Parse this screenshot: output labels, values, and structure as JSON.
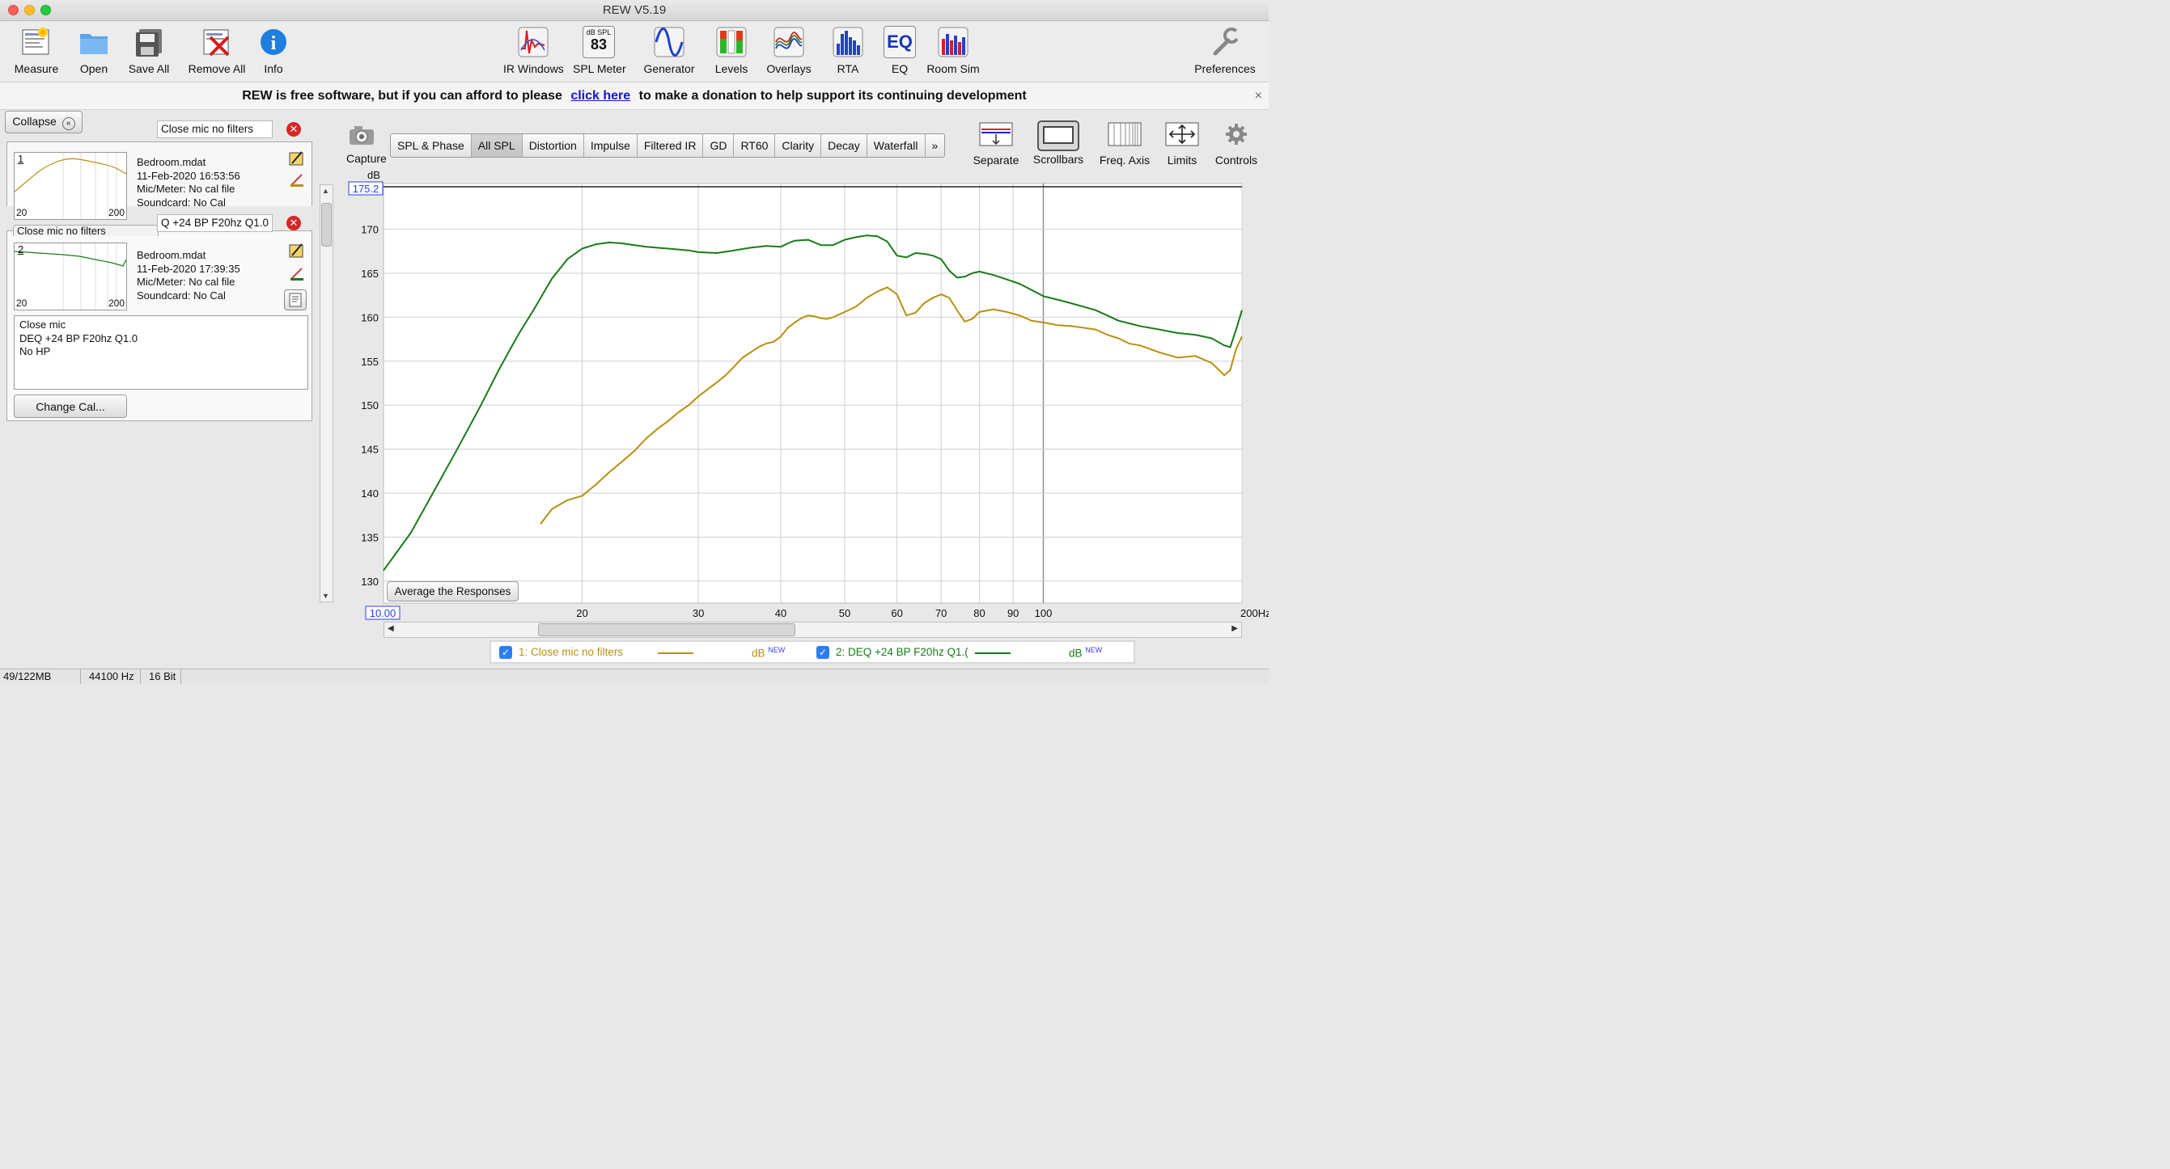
{
  "window": {
    "title": "REW V5.19"
  },
  "toolbar": {
    "measure": "Measure",
    "open": "Open",
    "save_all": "Save All",
    "remove_all": "Remove All",
    "info": "Info",
    "ir_windows": "IR Windows",
    "spl_meter": "SPL Meter",
    "spl_meter_icon_top": "dB SPL",
    "spl_meter_icon_value": "83",
    "generator": "Generator",
    "levels": "Levels",
    "overlays": "Overlays",
    "rta": "RTA",
    "eq": "EQ",
    "eq_icon_text": "EQ",
    "room_sim": "Room Sim",
    "preferences": "Preferences"
  },
  "banner": {
    "text_before": "REW is free software, but if you can afford to please",
    "link": "click here",
    "text_after": "to make a donation to help support its continuing development",
    "close": "×"
  },
  "left_panel": {
    "collapse": "Collapse",
    "measurements": [
      {
        "number": "1",
        "name": "Close mic no filters",
        "file": "Bedroom.mdat",
        "date": "11-Feb-2020 16:53:56",
        "mic": "Mic/Meter: No cal file",
        "soundcard": "Soundcard: No Cal",
        "axis_min": "20",
        "axis_max": "200",
        "color": "#b8900d"
      },
      {
        "number": "2",
        "name": "Q +24 BP F20hz Q1.0",
        "tab_label": "Close mic no filters",
        "file": "Bedroom.mdat",
        "date": "11-Feb-2020 17:39:35",
        "mic": "Mic/Meter: No cal file",
        "soundcard": "Soundcard: No Cal",
        "axis_min": "20",
        "axis_max": "200",
        "color": "#1a7a1a"
      }
    ],
    "notes": [
      "Close mic",
      "DEQ +24 BP F20hz Q1.0",
      "No HP"
    ],
    "change_cal": "Change Cal..."
  },
  "graph_tabs": [
    "SPL & Phase",
    "All SPL",
    "Distortion",
    "Impulse",
    "Filtered IR",
    "GD",
    "RT60",
    "Clarity",
    "Decay",
    "Waterfall",
    "»"
  ],
  "active_tab": "All SPL",
  "capture": "Capture",
  "right_tools": {
    "separate": "Separate",
    "scrollbars": "Scrollbars",
    "freq_axis": "Freq. Axis",
    "limits": "Limits",
    "controls": "Controls"
  },
  "average_button": "Average the Responses",
  "legend": [
    {
      "label": "1: Close mic no filters",
      "unit": "dB",
      "tag": "NEW",
      "color": "#b8900d"
    },
    {
      "label": "2: DEQ +24 BP F20hz Q1.(",
      "unit": "dB",
      "tag": "NEW",
      "color": "#1a7a1a"
    }
  ],
  "status": {
    "memory": "49/122MB",
    "rate": "44100 Hz",
    "bits": "16 Bit"
  },
  "chart_data": {
    "type": "line",
    "xlabel": "",
    "ylabel": "dB",
    "x_scale": "log",
    "xlim": [
      10,
      200
    ],
    "ylim_top_label": "175.2",
    "xlim_left_label": "10.00",
    "ylim": [
      127.5,
      175.2
    ],
    "x_ticks": [
      20,
      30,
      40,
      50,
      60,
      70,
      80,
      90,
      100,
      200
    ],
    "x_tick_labels": [
      "20",
      "30",
      "40",
      "50",
      "60",
      "70",
      "80",
      "90",
      "100",
      "200Hz"
    ],
    "y_ticks": [
      130,
      135,
      140,
      145,
      150,
      155,
      160,
      165,
      170
    ],
    "grid": true,
    "series": [
      {
        "name": "1: Close mic no filters",
        "color": "#b8900d",
        "x": [
          17.3,
          18,
          19,
          20,
          21,
          22,
          23,
          24,
          25,
          26,
          27,
          28,
          29,
          30,
          31,
          32,
          33,
          34,
          35,
          36,
          37,
          38,
          39,
          40,
          41,
          42,
          43,
          44,
          45,
          46,
          47,
          48,
          50,
          52,
          54,
          56,
          58,
          60,
          62,
          64,
          66,
          68,
          70,
          72,
          74,
          76,
          78,
          80,
          84,
          88,
          92,
          96,
          100,
          105,
          110,
          115,
          120,
          125,
          130,
          135,
          140,
          150,
          160,
          170,
          180,
          188,
          192,
          196,
          200
        ],
        "y": [
          136.5,
          138.2,
          139.2,
          139.7,
          141.0,
          142.4,
          143.6,
          144.8,
          146.2,
          147.3,
          148.2,
          149.2,
          150.0,
          151.0,
          151.8,
          152.6,
          153.4,
          154.4,
          155.4,
          156.0,
          156.6,
          157.0,
          157.2,
          157.8,
          158.8,
          159.4,
          159.9,
          160.2,
          160.1,
          159.9,
          159.8,
          160.0,
          160.6,
          161.2,
          162.2,
          162.9,
          163.4,
          162.6,
          160.2,
          160.5,
          161.6,
          162.2,
          162.6,
          162.2,
          160.8,
          159.5,
          159.8,
          160.6,
          160.9,
          160.6,
          160.2,
          159.6,
          159.4,
          159.1,
          159.0,
          158.8,
          158.6,
          158.0,
          157.6,
          157.0,
          156.8,
          156.0,
          155.4,
          155.6,
          154.8,
          153.4,
          154.0,
          156.4,
          157.8
        ]
      },
      {
        "name": "2: DEQ +24 BP F20hz Q1.(",
        "color": "#1a7a1a",
        "x": [
          10.0,
          11,
          12,
          13,
          14,
          15,
          16,
          17,
          18,
          19,
          20,
          21,
          22,
          23,
          24,
          25,
          27,
          29,
          30,
          32,
          34,
          36,
          38,
          40,
          41,
          42,
          44,
          46,
          48,
          50,
          52,
          54,
          56,
          58,
          60,
          62,
          64,
          66,
          68,
          70,
          72,
          74,
          76,
          78,
          80,
          84,
          88,
          92,
          96,
          100,
          105,
          110,
          115,
          120,
          125,
          130,
          135,
          140,
          150,
          160,
          170,
          180,
          188,
          192,
          196,
          200
        ],
        "y": [
          131.2,
          135.5,
          140.6,
          145.3,
          149.8,
          154.2,
          158.0,
          161.2,
          164.4,
          166.6,
          167.8,
          168.3,
          168.5,
          168.4,
          168.2,
          168.0,
          167.8,
          167.6,
          167.4,
          167.3,
          167.6,
          167.9,
          168.1,
          168.0,
          168.4,
          168.7,
          168.8,
          168.2,
          168.2,
          168.8,
          169.1,
          169.3,
          169.2,
          168.6,
          167.0,
          166.8,
          167.3,
          167.2,
          167.0,
          166.6,
          165.3,
          164.5,
          164.6,
          165.0,
          165.2,
          164.8,
          164.3,
          163.8,
          163.1,
          162.4,
          162.0,
          161.6,
          161.2,
          160.8,
          160.2,
          159.6,
          159.3,
          159.0,
          158.6,
          158.2,
          158.0,
          157.6,
          156.8,
          156.6,
          158.6,
          160.8
        ]
      }
    ]
  }
}
